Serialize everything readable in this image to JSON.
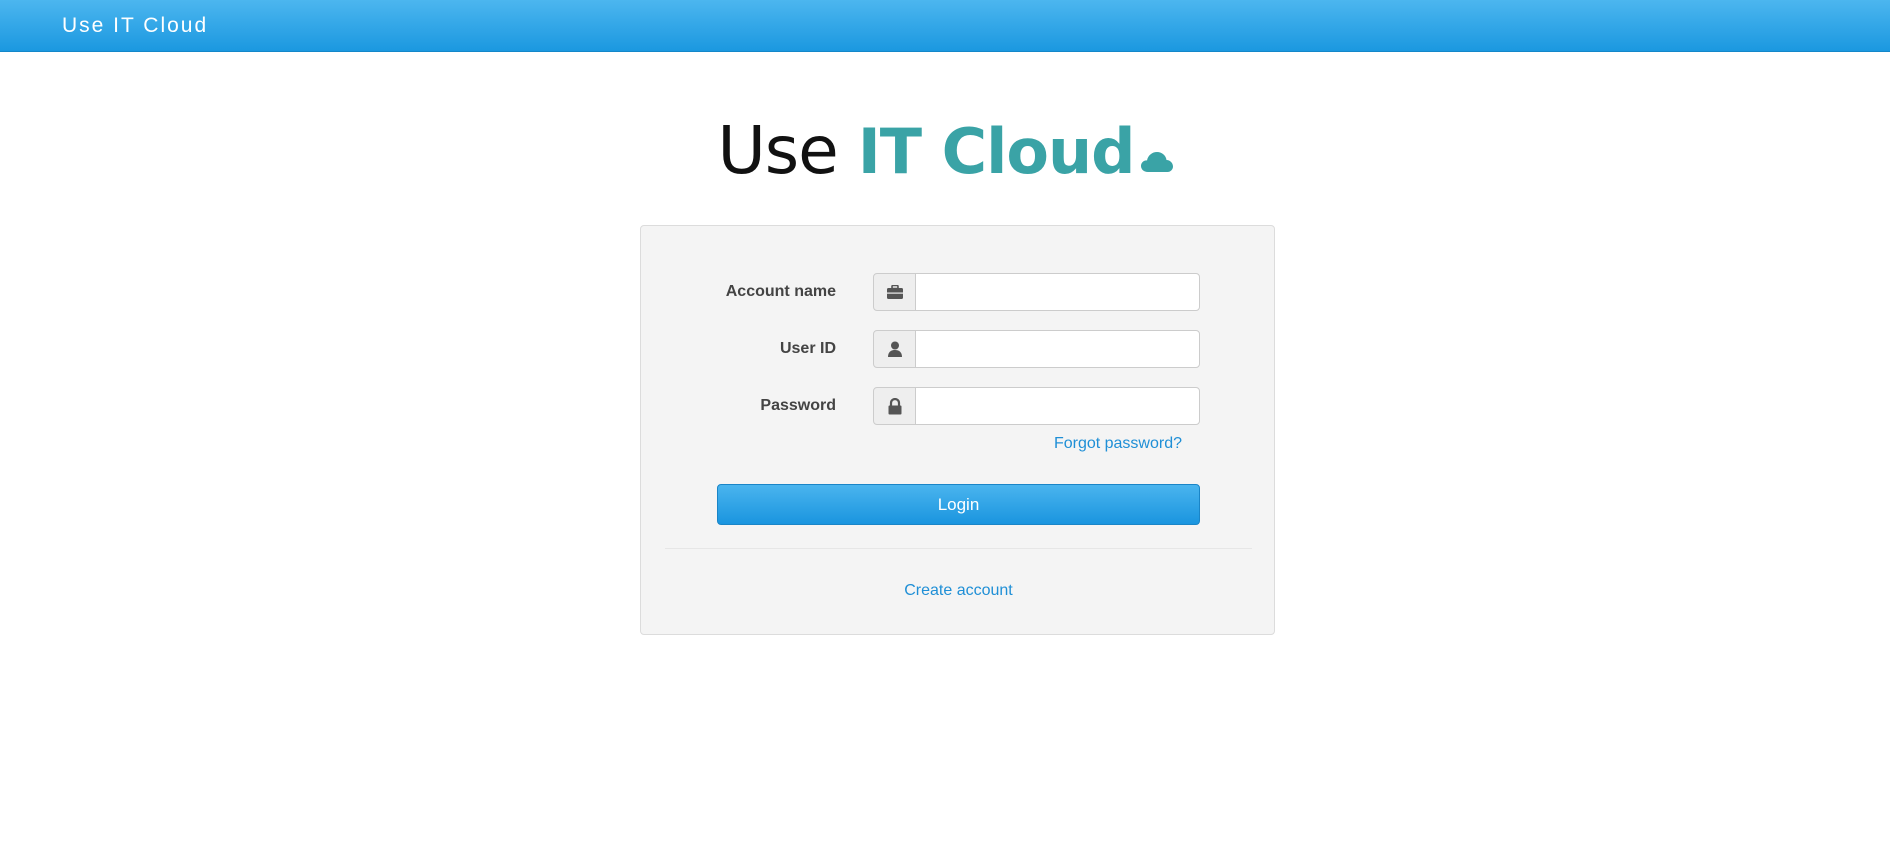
{
  "topbar": {
    "brand": "Use IT Cloud"
  },
  "logo": {
    "light_text": "Use ",
    "bold_text": "IT Cloud",
    "icon": "cloud-icon",
    "accent_color": "#3aa3a6"
  },
  "form": {
    "fields": [
      {
        "label": "Account name",
        "icon": "briefcase-icon",
        "value": "",
        "type": "text"
      },
      {
        "label": "User ID",
        "icon": "user-icon",
        "value": "",
        "type": "text"
      },
      {
        "label": "Password",
        "icon": "lock-icon",
        "value": "",
        "type": "password"
      }
    ],
    "forgot_link": "Forgot password?",
    "login_button": "Login",
    "create_account_link": "Create account"
  },
  "colors": {
    "topbar": "#1b98e0",
    "link": "#1f8fd6",
    "button": "#1a95df",
    "panel_bg": "#f4f4f4"
  }
}
